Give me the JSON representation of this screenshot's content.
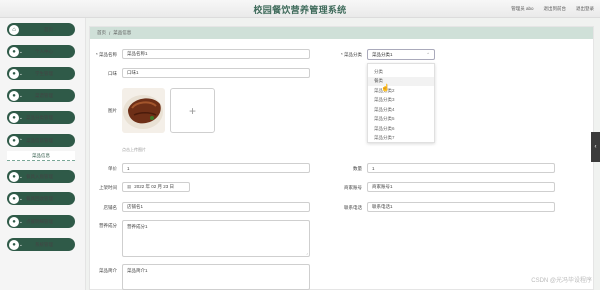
{
  "app_title": "校园餐饮营养管理系统",
  "top_links": [
    "管理员 abo",
    "退出到前台",
    "退出登录"
  ],
  "sidebar": {
    "items": [
      {
        "label": "首页",
        "has_chevron": false
      },
      {
        "label": "个人中心",
        "has_chevron": true
      },
      {
        "label": "学生管理",
        "has_chevron": true
      },
      {
        "label": "菜谱管理",
        "has_chevron": true
      },
      {
        "label": "菜品分类管理",
        "has_chevron": true
      },
      {
        "label": "菜品信息管理",
        "has_chevron": true
      },
      {
        "label": "餐具入盘管理",
        "has_chevron": true
      },
      {
        "label": "餐具回收管理",
        "has_chevron": true
      },
      {
        "label": "点餐明细管理",
        "has_chevron": true
      },
      {
        "label": "系统管理",
        "has_chevron": true
      }
    ],
    "active_submenu": "菜品信息"
  },
  "breadcrumb": {
    "home": "首页",
    "sep": "/",
    "current": "菜品信息"
  },
  "form": {
    "name_label": "* 菜品名称",
    "name_value": "菜品名称1",
    "category_label": "* 菜品分类",
    "category_value": "菜品分类1",
    "taste_label": "口味",
    "taste_value": "口味1",
    "image_label": "图片",
    "upload_hint": "点击上传图片",
    "price_label": "单价",
    "price_value": "1",
    "quantity_label": "数量",
    "quantity_value": "1",
    "date_label": "上架时间",
    "date_value": "2022 年 02 月 23 日",
    "merchant_no_label": "商家账号",
    "merchant_no_value": "商家账号1",
    "merchant_name_label": "店铺名",
    "merchant_name_value": "店铺名1",
    "phone_label": "联系电话",
    "phone_value": "联系电话1",
    "nutrition_label": "营养成分",
    "nutrition_value": "营养成分1",
    "intro_label": "菜品简介",
    "intro_value": "菜品简介1"
  },
  "category_options": [
    "分类",
    "餐类",
    "菜品分类2",
    "菜品分类3",
    "菜品分类4",
    "菜品分类5",
    "菜品分类6",
    "菜品分类7"
  ],
  "hovered_option": 1,
  "watermark": "CSDN @光冯毕设程序",
  "colors": {
    "accent": "#2f5a48",
    "breadcrumb_bg": "#cfe0d8"
  }
}
